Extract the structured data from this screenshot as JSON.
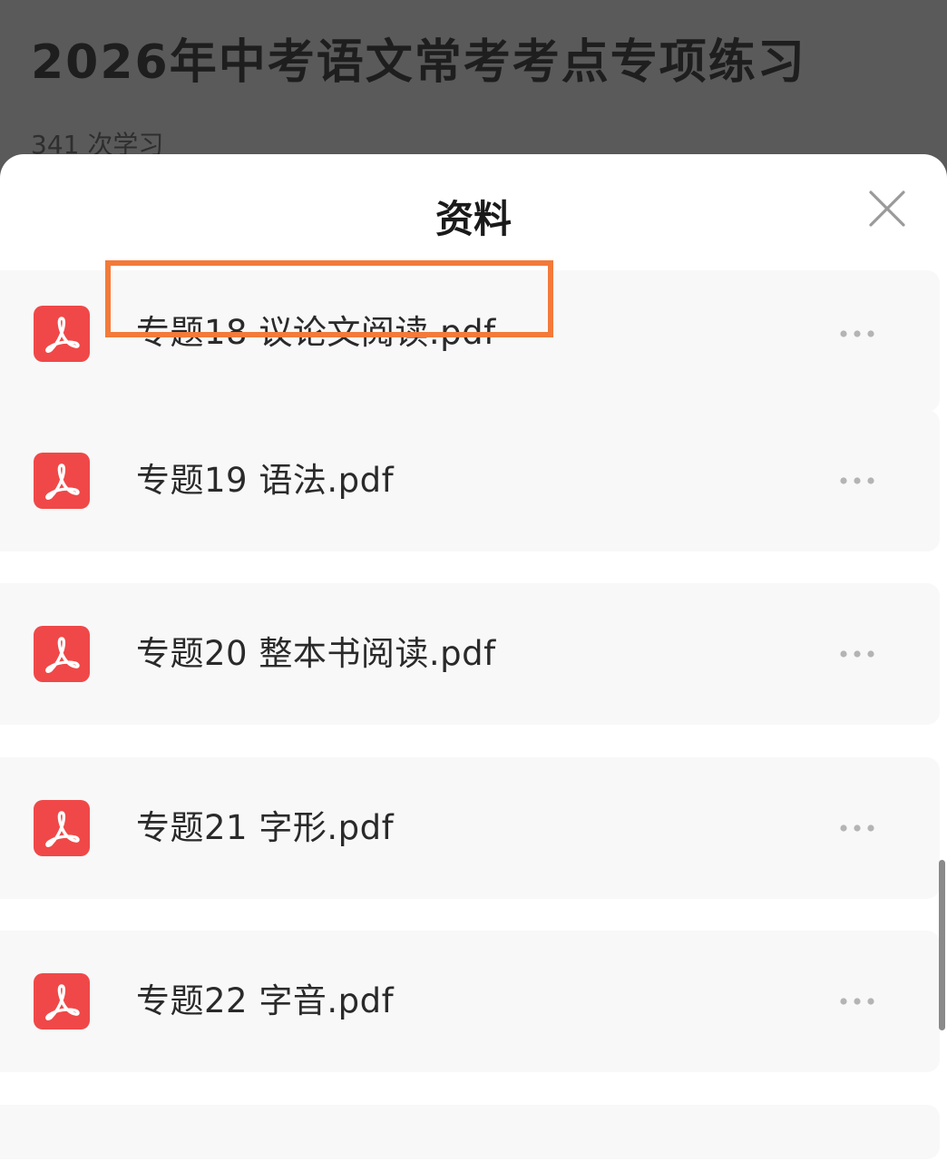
{
  "background": {
    "course_title": "2026年中考语文常考考点专项练习",
    "study_count": "341 次学习"
  },
  "sheet": {
    "title": "资料",
    "close_icon": "close-icon"
  },
  "files": [
    {
      "name": "专题18 议论文阅读.pdf",
      "icon": "pdf-icon",
      "highlighted": true
    },
    {
      "name": "专题19 语法.pdf",
      "icon": "pdf-icon",
      "highlighted": false
    },
    {
      "name": "专题20 整本书阅读.pdf",
      "icon": "pdf-icon",
      "highlighted": false
    },
    {
      "name": "专题21 字形.pdf",
      "icon": "pdf-icon",
      "highlighted": false
    },
    {
      "name": "专题22 字音.pdf",
      "icon": "pdf-icon",
      "highlighted": false
    }
  ],
  "colors": {
    "pdf_red": "#f04848",
    "highlight_orange": "#f37a3a",
    "overlay_gray": "#5a5a5a"
  }
}
